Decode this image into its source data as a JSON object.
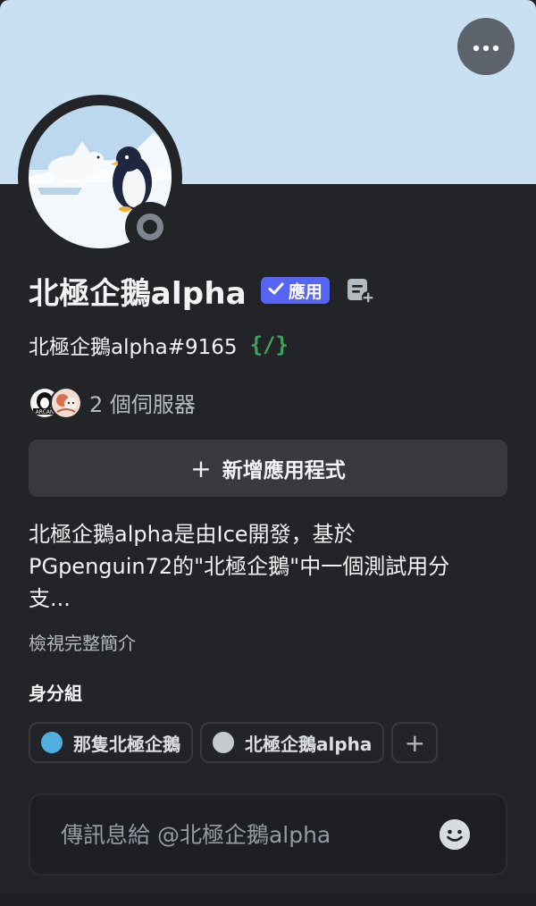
{
  "colors": {
    "banner": "#c9e0f2",
    "card_background": "#232428",
    "app_badge": "#5865f2",
    "slash_badge": "#3ba55c",
    "status_offline": "#80848e"
  },
  "header": {
    "more_button_icon": "ellipsis-icon",
    "avatar_description": "polar-bear-and-penguin-avatar",
    "status": "offline"
  },
  "profile": {
    "display_name": "北極企鵝alpha",
    "app_badge_label": "應用",
    "note_icon": "add-note-icon",
    "username": "北極企鵝alpha#9165",
    "slash_badge": "{/}"
  },
  "servers": {
    "count_label": "2 個伺服器",
    "icons": [
      "server-icon-arcane",
      "server-icon-second"
    ]
  },
  "add_app_button": {
    "label": "新增應用程式",
    "icon": "+"
  },
  "bio": {
    "lines": [
      "北極企鵝alpha是由Ice開發，基於",
      "PGpenguin72的\"北極企鵝\"中一個測試用分",
      "支..."
    ],
    "view_full_label": "檢視完整簡介"
  },
  "roles": {
    "title": "身分組",
    "items": [
      {
        "name": "那隻北極企鵝",
        "color": "#4fb0e0"
      },
      {
        "name": "北極企鵝alpha",
        "color": "#c4c9ce"
      }
    ],
    "add_icon": "+"
  },
  "message": {
    "placeholder": "傳訊息給 @北極企鵝alpha",
    "emoji_icon": "smiley-icon"
  }
}
